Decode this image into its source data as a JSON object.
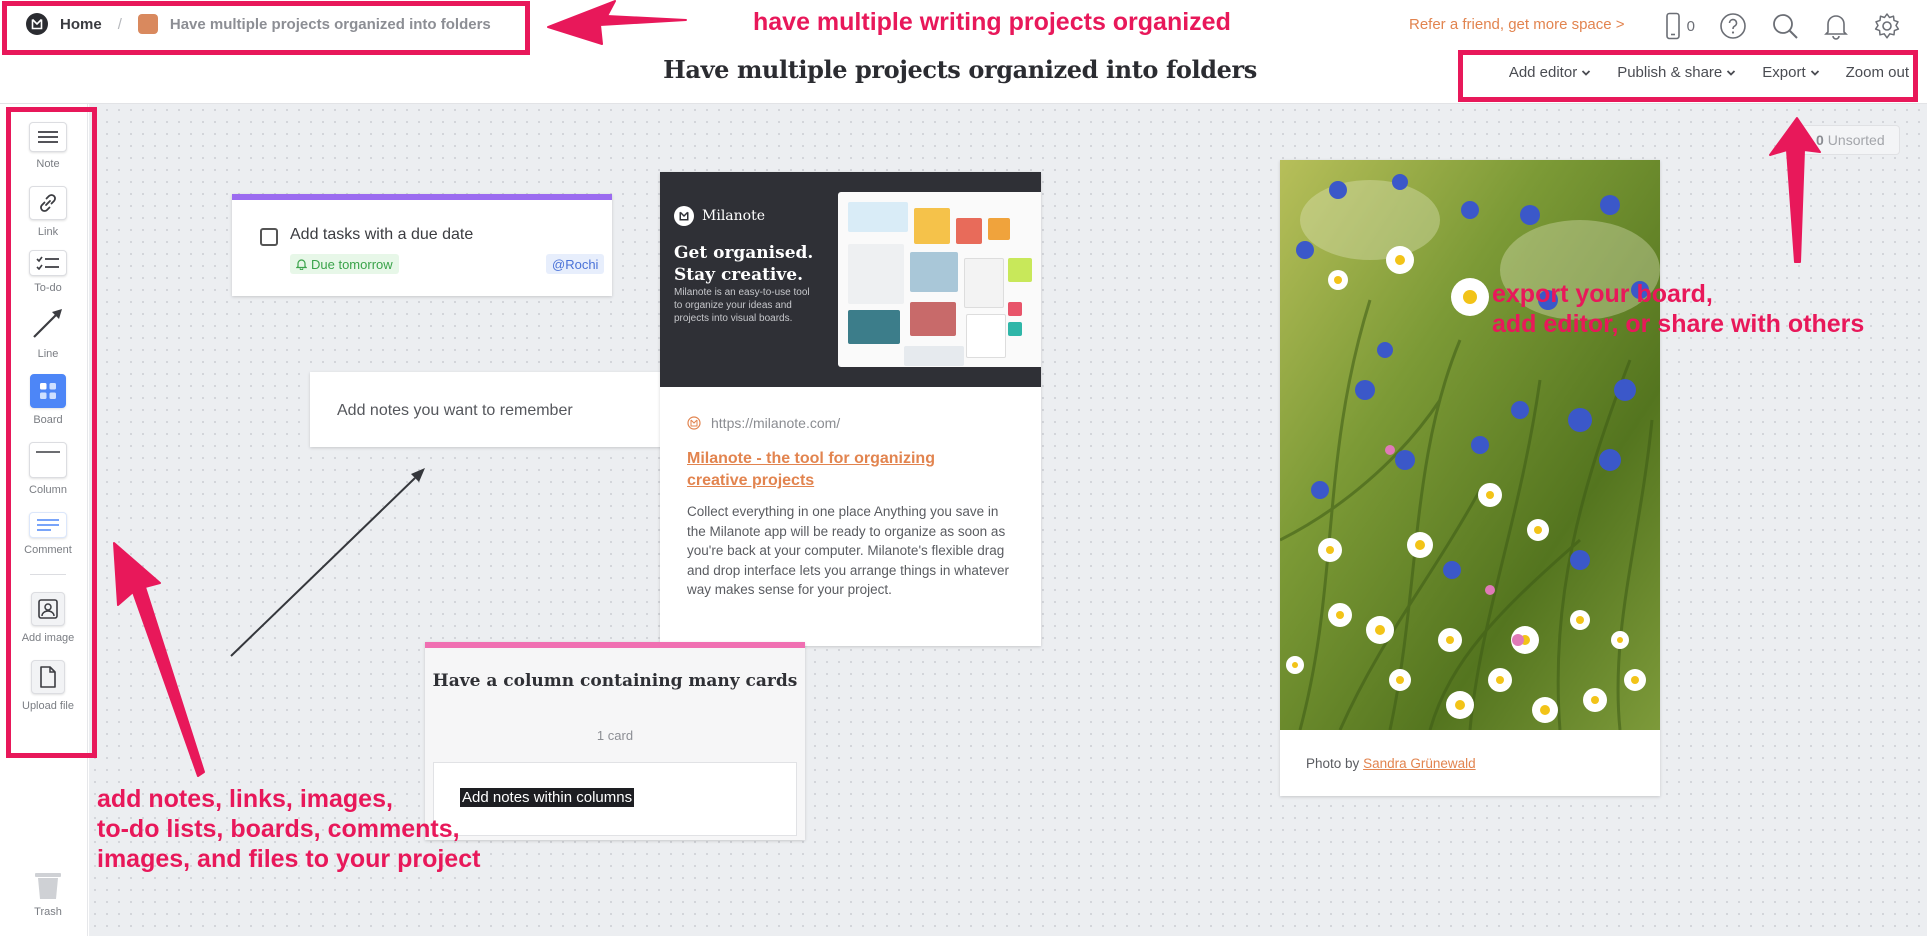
{
  "breadcrumb": {
    "home": "Home",
    "current": "Have multiple projects organized into folders"
  },
  "board_title": "Have multiple projects organized into folders",
  "header": {
    "refer": "Refer a friend, get more space >",
    "device_count": "0",
    "menu": {
      "add_editor": "Add editor",
      "publish": "Publish & share",
      "export": "Export",
      "zoom": "Zoom out"
    }
  },
  "tools": [
    {
      "label": "Note",
      "icon": "note-icon"
    },
    {
      "label": "Link",
      "icon": "link-icon"
    },
    {
      "label": "To-do",
      "icon": "todo-icon"
    },
    {
      "label": "Line",
      "icon": "line-icon"
    },
    {
      "label": "Board",
      "icon": "board-icon"
    },
    {
      "label": "Column",
      "icon": "column-icon"
    },
    {
      "label": "Comment",
      "icon": "comment-icon"
    },
    {
      "label": "Add image",
      "icon": "image-icon"
    },
    {
      "label": "Upload file",
      "icon": "file-icon"
    }
  ],
  "trash": "Trash",
  "unsorted": {
    "count": "0",
    "label": "Unsorted"
  },
  "cards": {
    "todo": {
      "text": "Add tasks with a due date",
      "due": "Due tomorrow",
      "mention": "@Rochi"
    },
    "note": {
      "text": "Add notes you want to remember"
    },
    "link": {
      "hero_brand": "Milanote",
      "hero_heading": "Get organised. Stay creative.",
      "hero_sub": "Milanote is an easy-to-use tool to organize your ideas and projects into visual boards.",
      "url": "https://milanote.com/",
      "title": "Milanote - the tool for organizing creative projects",
      "desc": "Collect everything in one place Anything you save in the Milanote app will be ready to organize as soon as you're back at your computer. Milanote's flexible drag and drop interface lets you arrange things in whatever way makes sense for your project."
    },
    "column": {
      "title": "Have a column containing many cards",
      "count": "1 card",
      "inner": "Add notes within columns"
    },
    "image": {
      "credit_prefix": "Photo by",
      "credit_name": "Sandra Grünewald"
    }
  },
  "annotations": {
    "top": "have multiple writing projects organized",
    "right": [
      "export your board,",
      "add editor, or share with others"
    ],
    "bottom": [
      "add notes, links, images,",
      "to-do lists, boards, comments,",
      "images, and files to your project"
    ]
  },
  "colors": {
    "accent_orange": "#e2844f",
    "annotation_pink": "#e8185a",
    "todo_purple": "#9b6bf0",
    "column_pink": "#f06fb2"
  }
}
